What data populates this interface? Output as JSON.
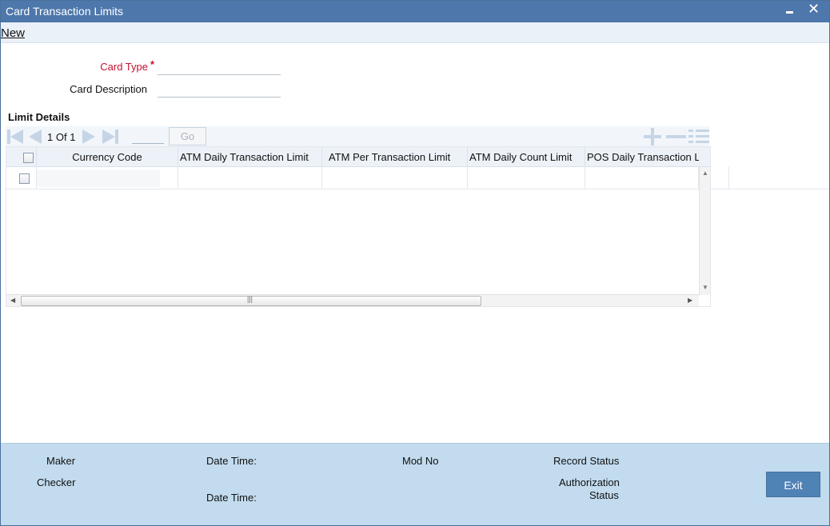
{
  "window": {
    "title": "Card Transaction Limits"
  },
  "menu": {
    "new_label": "New"
  },
  "form": {
    "card_type_label": "Card Type",
    "card_type_required": "*",
    "card_type_value": "",
    "card_description_label": "Card Description",
    "card_description_value": ""
  },
  "limit_details": {
    "title": "Limit Details",
    "pagination": {
      "current": "1",
      "of_label": "Of",
      "total": "1",
      "go_label": "Go",
      "page_input": ""
    },
    "columns": [
      "Currency Code",
      "ATM Daily Transaction Limit",
      "ATM Per Transaction Limit",
      "ATM Daily Count Limit",
      "POS Daily Transaction Limit"
    ],
    "rows": [
      {
        "currency_code": "",
        "atm_daily_transaction_limit": "",
        "atm_per_transaction_limit": "",
        "atm_daily_count_limit": "",
        "pos_daily_transaction_limit": ""
      }
    ]
  },
  "footer": {
    "maker_label": "Maker",
    "checker_label": "Checker",
    "date_time_label_1": "Date Time:",
    "date_time_label_2": "Date Time:",
    "mod_no_label": "Mod No",
    "record_status_label": "Record Status",
    "authorization_label": "Authorization",
    "status_label": "Status",
    "exit_label": "Exit"
  },
  "colors": {
    "titlebar": "#4e77ab",
    "footer": "#c2dbee",
    "exit_button": "#4f82b5",
    "required": "#c8102e"
  },
  "icons": [
    "minimize-icon",
    "close-icon",
    "first-page-icon",
    "previous-page-icon",
    "next-page-icon",
    "last-page-icon",
    "add-row-icon",
    "delete-row-icon",
    "single-record-view-icon"
  ]
}
